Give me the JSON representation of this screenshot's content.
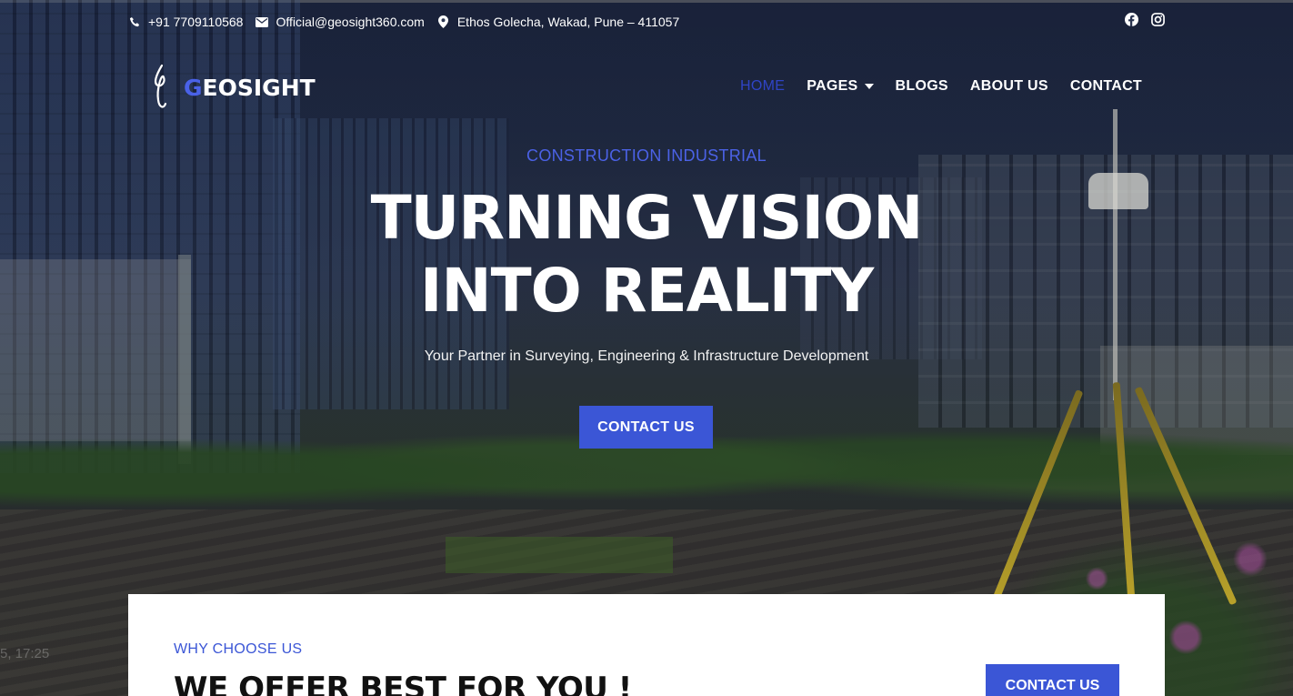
{
  "topbar": {
    "phone": "+91 7709110568",
    "email": "Official@geosight360.com",
    "address": "Ethos Golecha, Wakad, Pune – 411057",
    "icons": [
      "phone-icon",
      "mail-icon",
      "location-pin-icon"
    ],
    "social_icons": [
      "facebook-icon",
      "instagram-icon"
    ]
  },
  "brand": {
    "initial": "G",
    "rest": "EOSIGHT",
    "accent_color": "#3b56d6"
  },
  "nav": {
    "items": [
      {
        "label": "HOME",
        "active": true
      },
      {
        "label": "PAGES",
        "has_dropdown": true
      },
      {
        "label": "BLOGS"
      },
      {
        "label": "ABOUT US"
      },
      {
        "label": "CONTACT"
      }
    ]
  },
  "hero": {
    "eyebrow": "CONSTRUCTION INDUSTRIAL",
    "headline_line1": "TURNING VISION",
    "headline_line2": "INTO REALITY",
    "subtitle": "Your Partner in Surveying, Engineering & Infrastructure Development",
    "cta_label": "CONTACT US",
    "overlay_text": "5, 17:25"
  },
  "why_section": {
    "eyebrow": "WHY CHOOSE US",
    "title": "WE OFFER BEST FOR YOU !",
    "cta_label": "CONTACT US"
  }
}
